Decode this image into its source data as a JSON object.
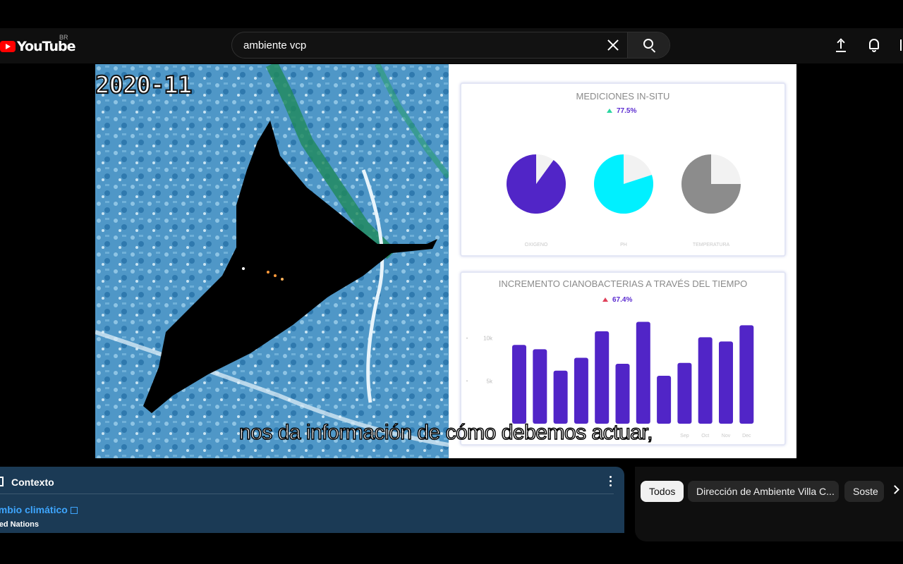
{
  "header": {
    "logo_text": "YouTube",
    "country_code": "BR",
    "search_value": "ambiente vcp",
    "icons": [
      "close-icon",
      "search-icon",
      "upload-icon",
      "bell-icon"
    ]
  },
  "video": {
    "date_stamp": "2020-11",
    "subtitle": "nos da información de cómo debemos actuar,",
    "dashboard": {
      "card1": {
        "title": "MEDICIONES IN-SITU",
        "stat": "77.5%",
        "chart_data": {
          "type": "pie",
          "labels": [
            "OXIGENO",
            "PH",
            "TEMPERATURA"
          ],
          "values": [
            0.9,
            0.8,
            0.75
          ],
          "colors": [
            "#5125c7",
            "#00f0ff",
            "#8c8c8c"
          ],
          "remainder_color": "#f2f2f2"
        }
      },
      "card2": {
        "title": "INCREMENTO CIANOBACTERIAS A TRAVÉS DEL TIEMPO",
        "stat": "67.4%",
        "chart_data": {
          "type": "bar",
          "categories": [
            "",
            "",
            "",
            "",
            "",
            "",
            "",
            "",
            "Sep",
            "Oct",
            "Nov",
            "Dec"
          ],
          "values": [
            9200,
            8700,
            6200,
            7700,
            10800,
            7000,
            11900,
            5600,
            7100,
            10100,
            9600,
            11500
          ],
          "y_ticks": [
            "10k",
            "5k"
          ],
          "ylim": [
            0,
            14000
          ],
          "color": "#5125c7"
        }
      }
    }
  },
  "context": {
    "title": "Contexto",
    "link_text": "ambio climático",
    "source": "ited Nations"
  },
  "chips": [
    {
      "label": "Todos",
      "active": true
    },
    {
      "label": "Dirección de Ambiente Villa C...",
      "active": false
    },
    {
      "label": "Soste",
      "active": false
    }
  ]
}
